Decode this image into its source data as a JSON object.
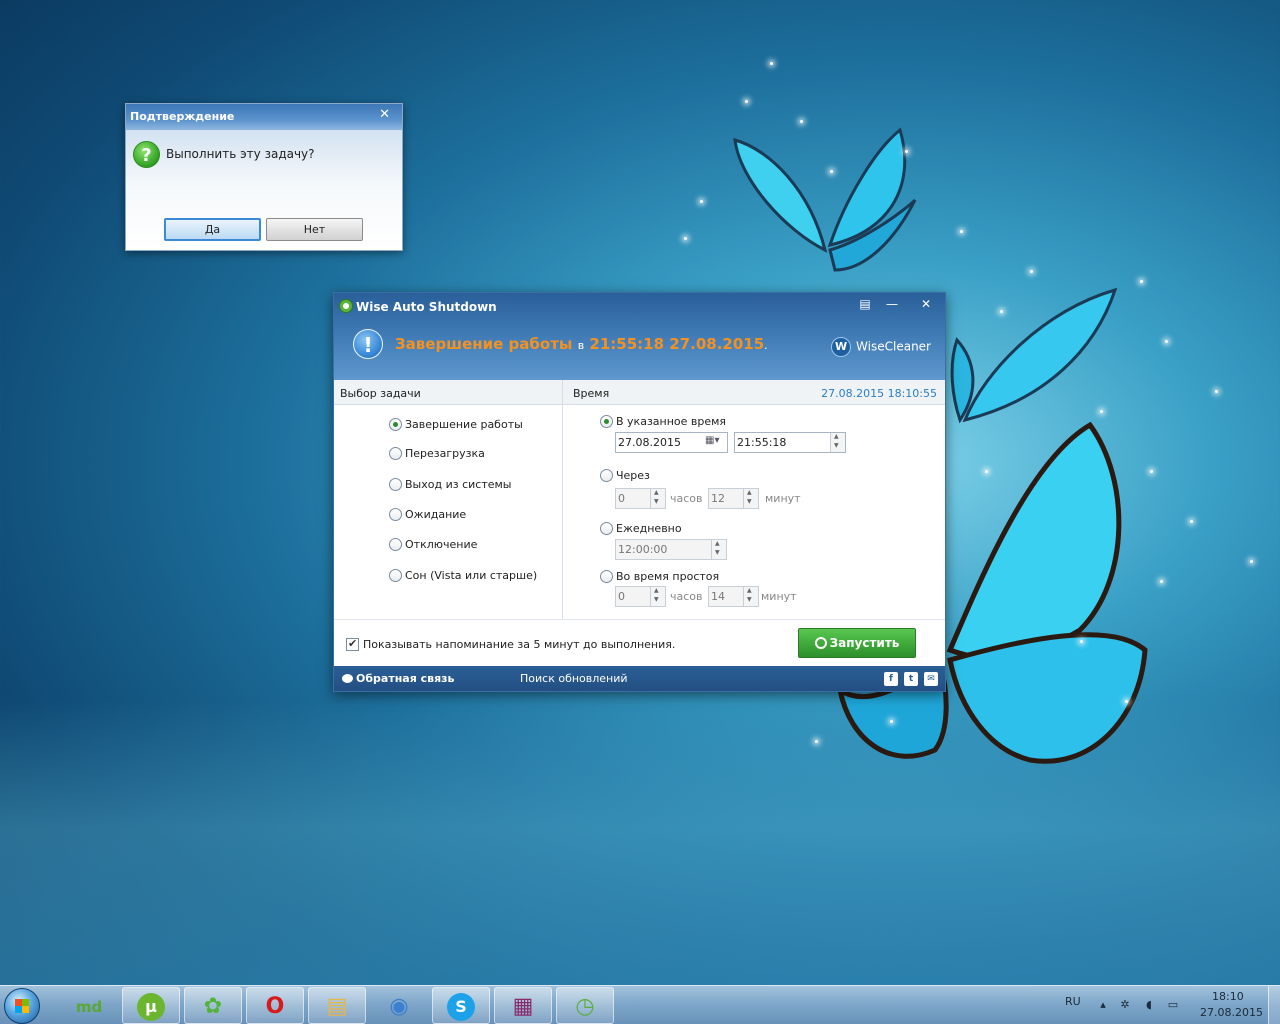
{
  "confirm_dialog": {
    "title": "Подтверждение",
    "close_glyph": "✕",
    "question_glyph": "?",
    "message": "Выполнить эту задачу?",
    "yes_label": "Да",
    "no_label": "Нет"
  },
  "app": {
    "title": "Wise Auto Shutdown",
    "controls": {
      "menu": "▤",
      "minimize": "—",
      "close": "✕"
    },
    "status": {
      "action": "Завершение работы",
      "connector": "в",
      "datetime": "21:55:18 27.08.2015",
      "period": "."
    },
    "info_glyph": "!",
    "brand": {
      "logo_letter": "W",
      "name": "WiseCleaner"
    },
    "task_header": "Выбор задачи",
    "time_header": "Время",
    "current_datetime": "27.08.2015 18:10:55",
    "tasks": [
      {
        "label": "Завершение работы",
        "selected": true
      },
      {
        "label": "Перезагрузка",
        "selected": false
      },
      {
        "label": "Выход из системы",
        "selected": false
      },
      {
        "label": "Ожидание",
        "selected": false
      },
      {
        "label": "Отключение",
        "selected": false
      },
      {
        "label": "Сон (Vista или старше)",
        "selected": false
      }
    ],
    "schedule": {
      "at_time": {
        "label": "В указанное время",
        "selected": true,
        "date": "27.08.2015",
        "time": "21:55:18",
        "calendar_glyph": "▦▾"
      },
      "after": {
        "label": "Через",
        "selected": false,
        "hours": "0",
        "hours_unit": "часов",
        "minutes": "12",
        "minutes_unit": "минут"
      },
      "daily": {
        "label": "Ежедневно",
        "selected": false,
        "time": "12:00:00"
      },
      "idle": {
        "label": "Во время простоя",
        "selected": false,
        "hours": "0",
        "hours_unit": "часов",
        "minutes": "14",
        "minutes_unit": "минут"
      }
    },
    "reminder_label": "Показывать напоминание за 5 минут до выполнения.",
    "reminder_checked": true,
    "run_label": "Запустить",
    "footer": {
      "feedback": "Обратная связь",
      "updates": "Поиск обновлений",
      "social": [
        "f",
        "t",
        "✉"
      ]
    }
  },
  "taskbar": {
    "pinned": [
      {
        "name": "mydrive",
        "glyph": "md",
        "color": "#5aa832"
      },
      {
        "name": "utorrent",
        "glyph": "µ",
        "color": "#6bb52f"
      },
      {
        "name": "icq",
        "glyph": "✿",
        "color": "#53b43a"
      },
      {
        "name": "opera",
        "glyph": "O",
        "color": "#d71a1a"
      },
      {
        "name": "explorer",
        "glyph": "▤",
        "color": "#e8b547"
      },
      {
        "name": "browser",
        "glyph": "◉",
        "color": "#3a7fd0"
      },
      {
        "name": "skype",
        "glyph": "S",
        "color": "#1da1e8"
      },
      {
        "name": "winrar",
        "glyph": "▦",
        "color": "#8a2a6a"
      },
      {
        "name": "wise-auto-shutdown",
        "glyph": "◷",
        "color": "#5cae3c"
      }
    ],
    "language": "RU",
    "clock_time": "18:10",
    "clock_date": "27.08.2015"
  }
}
